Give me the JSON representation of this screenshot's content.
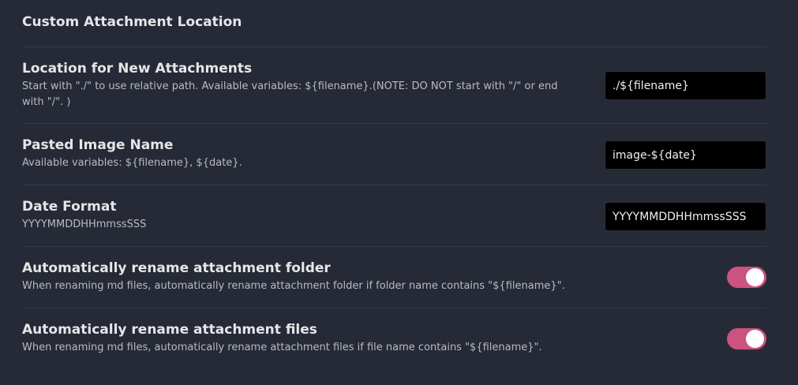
{
  "section_title": "Custom Attachment Location",
  "settings": [
    {
      "name": "Location for New Attachments",
      "description": "Start with \"./\" to use relative path. Available variables: ${filename}.(NOTE: DO NOT start with \"/\" or end with \"/\". )",
      "value": "./${filename}"
    },
    {
      "name": "Pasted Image Name",
      "description": "Available variables: ${filename}, ${date}.",
      "value": "image-${date}"
    },
    {
      "name": "Date Format",
      "description": "YYYYMMDDHHmmssSSS",
      "value": "YYYYMMDDHHmmssSSS"
    },
    {
      "name": "Automatically rename attachment folder",
      "description": "When renaming md files, automatically rename attachment folder if folder name contains \"${filename}\".",
      "enabled": true
    },
    {
      "name": "Automatically rename attachment files",
      "description": "When renaming md files, automatically rename attachment files if file name contains \"${filename}\".",
      "enabled": true
    }
  ],
  "colors": {
    "background": "#262a36",
    "accent": "#cc527f",
    "input_bg": "#000000"
  }
}
